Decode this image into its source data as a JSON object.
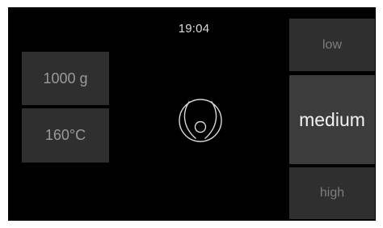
{
  "status_bar": {
    "time": "19:04"
  },
  "settings": {
    "weight": "1000 g",
    "temperature": "160°C"
  },
  "intensity_levels": [
    {
      "label": "low",
      "selected": false
    },
    {
      "label": "medium",
      "selected": true
    },
    {
      "label": "high",
      "selected": false
    }
  ],
  "center": {
    "icon": "robot-vacuum-logo-icon"
  },
  "colors": {
    "background": "#000000",
    "tile": "#2f2f2f",
    "tile_selected": "#3c3c3c",
    "text_dim": "#9a9a9a",
    "text_selected": "#f2f2f2"
  }
}
